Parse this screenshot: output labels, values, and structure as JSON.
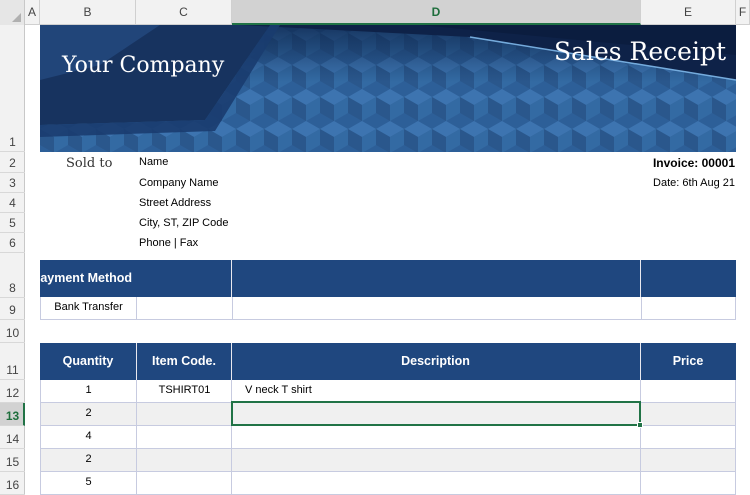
{
  "columns": [
    "A",
    "B",
    "C",
    "D",
    "E",
    "F"
  ],
  "selected_column": "D",
  "rows": [
    "1",
    "2",
    "3",
    "4",
    "5",
    "6",
    "8",
    "9",
    "10",
    "11",
    "12",
    "13",
    "14",
    "15",
    "16"
  ],
  "selected_row": "13",
  "banner": {
    "company": "Your Company",
    "title": "Sales Receipt"
  },
  "sold_to": {
    "label": "Sold to",
    "lines": [
      "Name",
      "Company Name",
      "Street Address",
      "City, ST,  ZIP Code",
      "Phone | Fax"
    ]
  },
  "invoice": {
    "number": "Invoice: 00001",
    "date": "Date: 6th Aug 21"
  },
  "payment": {
    "header": "Payment Method",
    "value": "Bank Transfer"
  },
  "items": {
    "headers": [
      "Quantity",
      "Item Code.",
      "Description",
      "Price"
    ],
    "rows": [
      {
        "qty": "1",
        "code": "TSHIRT01",
        "desc": "V neck T shirt"
      },
      {
        "qty": "2",
        "code": "",
        "desc": ""
      },
      {
        "qty": "4",
        "code": "",
        "desc": ""
      },
      {
        "qty": "2",
        "code": "",
        "desc": ""
      },
      {
        "qty": "5",
        "code": "",
        "desc": ""
      }
    ]
  },
  "colors": {
    "header_blue": "#1f477f",
    "banner_blue": "#2a5a93",
    "selection_green": "#217346"
  }
}
